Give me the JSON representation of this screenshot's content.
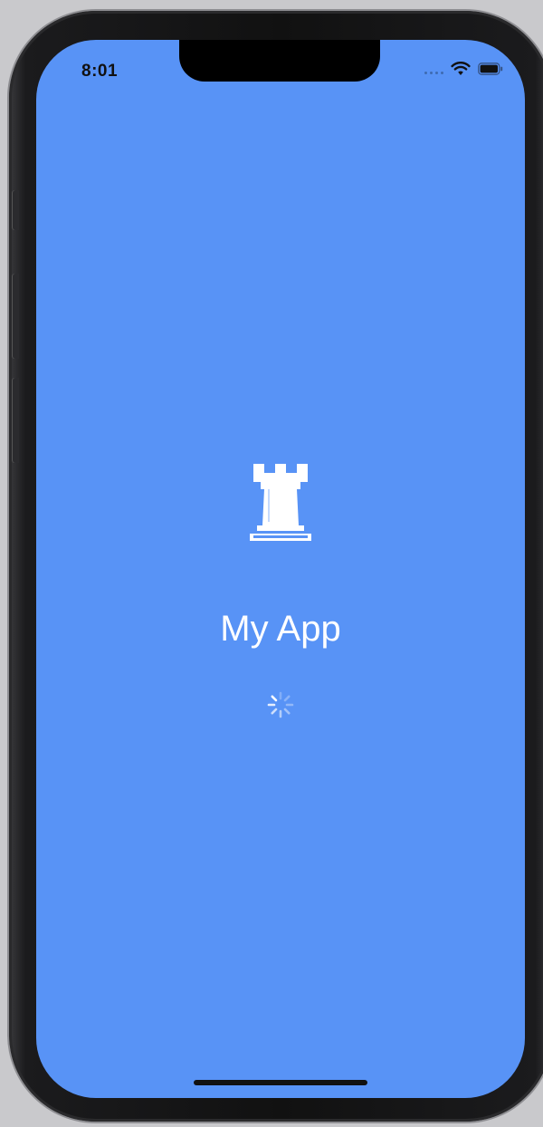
{
  "status_bar": {
    "time": "8:01",
    "signal_icon": "cellular-signal-icon",
    "wifi_icon": "wifi-icon",
    "battery_icon": "battery-icon"
  },
  "splash": {
    "logo_icon": "chess-rook-icon",
    "app_name": "My App",
    "spinner_icon": "loading-spinner-icon"
  },
  "colors": {
    "background": "#5893f6",
    "foreground": "#ffffff"
  }
}
